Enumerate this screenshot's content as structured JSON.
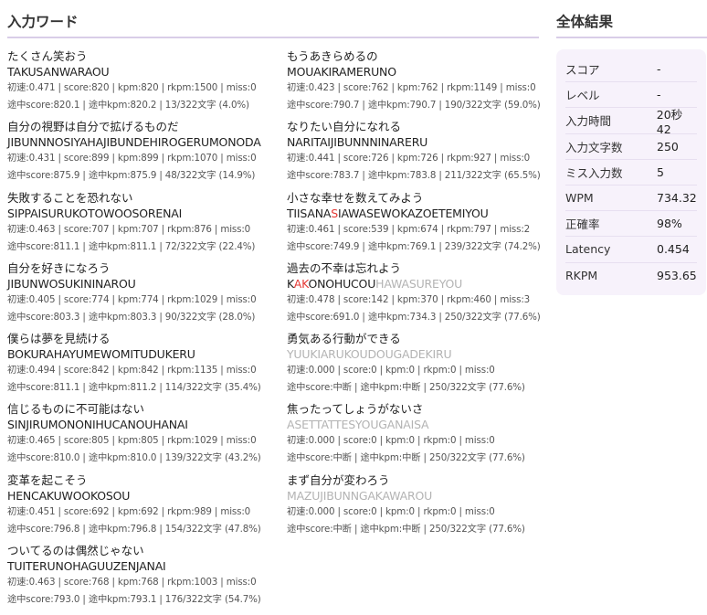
{
  "input_section": {
    "title": "入力ワード"
  },
  "result_section": {
    "title": "全体結果"
  },
  "words_left": [
    {
      "jp": "たくさん笑おう",
      "romaji": "TAKUSANWARAOU",
      "line1": "初速:0.471 | score:820 | kpm:820 | rkpm:1500 | miss:0",
      "line2": "途中score:820.1 | 途中kpm:820.2 | 13/322文字 (4.0%)"
    },
    {
      "jp": "自分の視野は自分で拡げるものだ",
      "romaji": "JIBUNNNOSIYAHAJIBUNDEHIROGERUMONODA",
      "line1": "初速:0.431 | score:899 | kpm:899 | rkpm:1070 | miss:0",
      "line2": "途中score:875.9 | 途中kpm:875.9 | 48/322文字 (14.9%)"
    },
    {
      "jp": "失敗することを恐れない",
      "romaji": "SIPPAISURUKOTOWOOSORENAI",
      "line1": "初速:0.463 | score:707 | kpm:707 | rkpm:876 | miss:0",
      "line2": "途中score:811.1 | 途中kpm:811.1 | 72/322文字 (22.4%)"
    },
    {
      "jp": "自分を好きになろう",
      "romaji": "JIBUNWOSUKININAROU",
      "line1": "初速:0.405 | score:774 | kpm:774 | rkpm:1029 | miss:0",
      "line2": "途中score:803.3 | 途中kpm:803.3 | 90/322文字 (28.0%)"
    },
    {
      "jp": "僕らは夢を見続ける",
      "romaji": "BOKURAHAYUMEWOMITUDUKERU",
      "line1": "初速:0.494 | score:842 | kpm:842 | rkpm:1135 | miss:0",
      "line2": "途中score:811.1 | 途中kpm:811.2 | 114/322文字 (35.4%)"
    },
    {
      "jp": "信じるものに不可能はない",
      "romaji": "SINJIRUMONONIHUCANOUHANAI",
      "line1": "初速:0.465 | score:805 | kpm:805 | rkpm:1029 | miss:0",
      "line2": "途中score:810.0 | 途中kpm:810.0 | 139/322文字 (43.2%)"
    },
    {
      "jp": "変革を起こそう",
      "romaji": "HENCAKUWOOKOSOU",
      "line1": "初速:0.451 | score:692 | kpm:692 | rkpm:989 | miss:0",
      "line2": "途中score:796.8 | 途中kpm:796.8 | 154/322文字 (47.8%)"
    },
    {
      "jp": "ついてるのは偶然じゃない",
      "romaji": "TUITERUNOHAGUUZENJANAI",
      "line1": "初速:0.463 | score:768 | kpm:768 | rkpm:1003 | miss:0",
      "line2": "途中score:793.0 | 途中kpm:793.1 | 176/322文字 (54.7%)"
    }
  ],
  "words_right": [
    {
      "jp": "もうあきらめるの",
      "romaji": "MOUAKIRAMERUNO",
      "line1": "初速:0.423 | score:762 | kpm:762 | rkpm:1149 | miss:0",
      "line2": "途中score:790.7 | 途中kpm:790.7 | 190/322文字 (59.0%)"
    },
    {
      "jp": "なりたい自分になれる",
      "romaji": "NARITAIJIBUNNNINARERU",
      "line1": "初速:0.441 | score:726 | kpm:726 | rkpm:927 | miss:0",
      "line2": "途中score:783.7 | 途中kpm:783.8 | 211/322文字 (65.5%)"
    },
    {
      "jp": "小さな幸せを数えてみよう",
      "romaji_parts": [
        "TIISANA",
        "S",
        "IAWASEWOKAZOETEMIYOU"
      ],
      "line1": "初速:0.461 | score:539 | kpm:674 | rkpm:797 | miss:2",
      "line2": "途中score:749.9 | 途中kpm:769.1 | 239/322文字 (74.2%)"
    },
    {
      "jp": "過去の不幸は忘れよう",
      "romaji_parts": [
        "K",
        "AK",
        "ONOHUCOU",
        "HAWASUREYOU"
      ],
      "line1": "初速:0.478 | score:142 | kpm:370 | rkpm:460 | miss:3",
      "line2": "途中score:691.0 | 途中kpm:734.3 | 250/322文字 (77.6%)"
    },
    {
      "jp": "勇気ある行動ができる",
      "romaji": "YUUKIARUKOUDOUGADEKIRU",
      "line1": "初速:0.000 | score:0 | kpm:0 | rkpm:0 | miss:0",
      "line2": "途中score:中断 | 途中kpm:中断 | 250/322文字 (77.6%)"
    },
    {
      "jp": "焦ったってしょうがないさ",
      "romaji": "ASETTATTESYOUGANAISA",
      "line1": "初速:0.000 | score:0 | kpm:0 | rkpm:0 | miss:0",
      "line2": "途中score:中断 | 途中kpm:中断 | 250/322文字 (77.6%)"
    },
    {
      "jp": "まず自分が変わろう",
      "romaji": "MAZUJIBUNNGAKAWAROU",
      "line1": "初速:0.000 | score:0 | kpm:0 | rkpm:0 | miss:0",
      "line2": "途中score:中断 | 途中kpm:中断 | 250/322文字 (77.6%)"
    }
  ],
  "results": [
    {
      "label": "スコア",
      "value": "-"
    },
    {
      "label": "レベル",
      "value": "-"
    },
    {
      "label": "入力時間",
      "value": "20秒42"
    },
    {
      "label": "入力文字数",
      "value": "250"
    },
    {
      "label": "ミス入力数",
      "value": "5"
    },
    {
      "label": "WPM",
      "value": "734.32"
    },
    {
      "label": "正確率",
      "value": "98%"
    },
    {
      "label": "Latency",
      "value": "0.454"
    },
    {
      "label": "RKPM",
      "value": "953.65"
    }
  ],
  "colors": {
    "accent_border": "#d9cde8",
    "panel_bg": "#f7f2fb",
    "miss_red": "#e53935",
    "pending_gray": "#b3b3b3"
  }
}
